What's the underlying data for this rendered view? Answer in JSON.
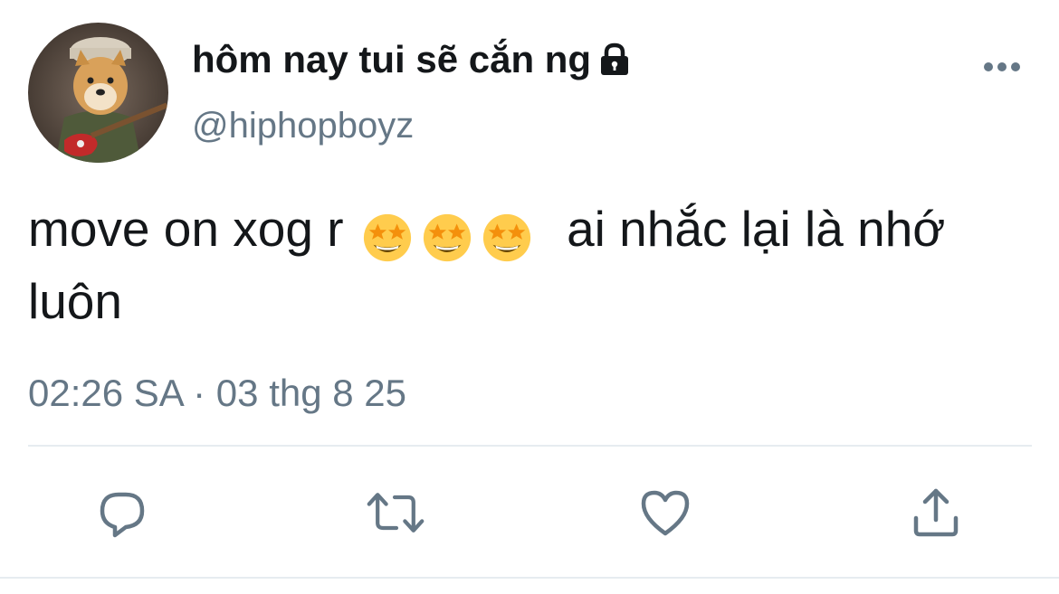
{
  "tweet": {
    "display_name": "hôm nay tui sẽ cắn ng",
    "handle": "@hiphopboyz",
    "text_before": "move on xog r",
    "emojis": [
      "star-struck",
      "star-struck",
      "star-struck"
    ],
    "text_after": "ai nhắc lại là nhớ luôn",
    "timestamp": "02:26 SA · 03 thg 8 25",
    "avatar_icon": "shiba-dog-guitar-avatar",
    "lock_icon": "lock-icon"
  },
  "actions": [
    "reply",
    "retweet",
    "like",
    "share"
  ],
  "colors": {
    "text": "#14171a",
    "secondary": "#657786",
    "divider": "#e6ecf0",
    "emoji_face": "#ffcc4d",
    "emoji_star": "#f4900c"
  }
}
